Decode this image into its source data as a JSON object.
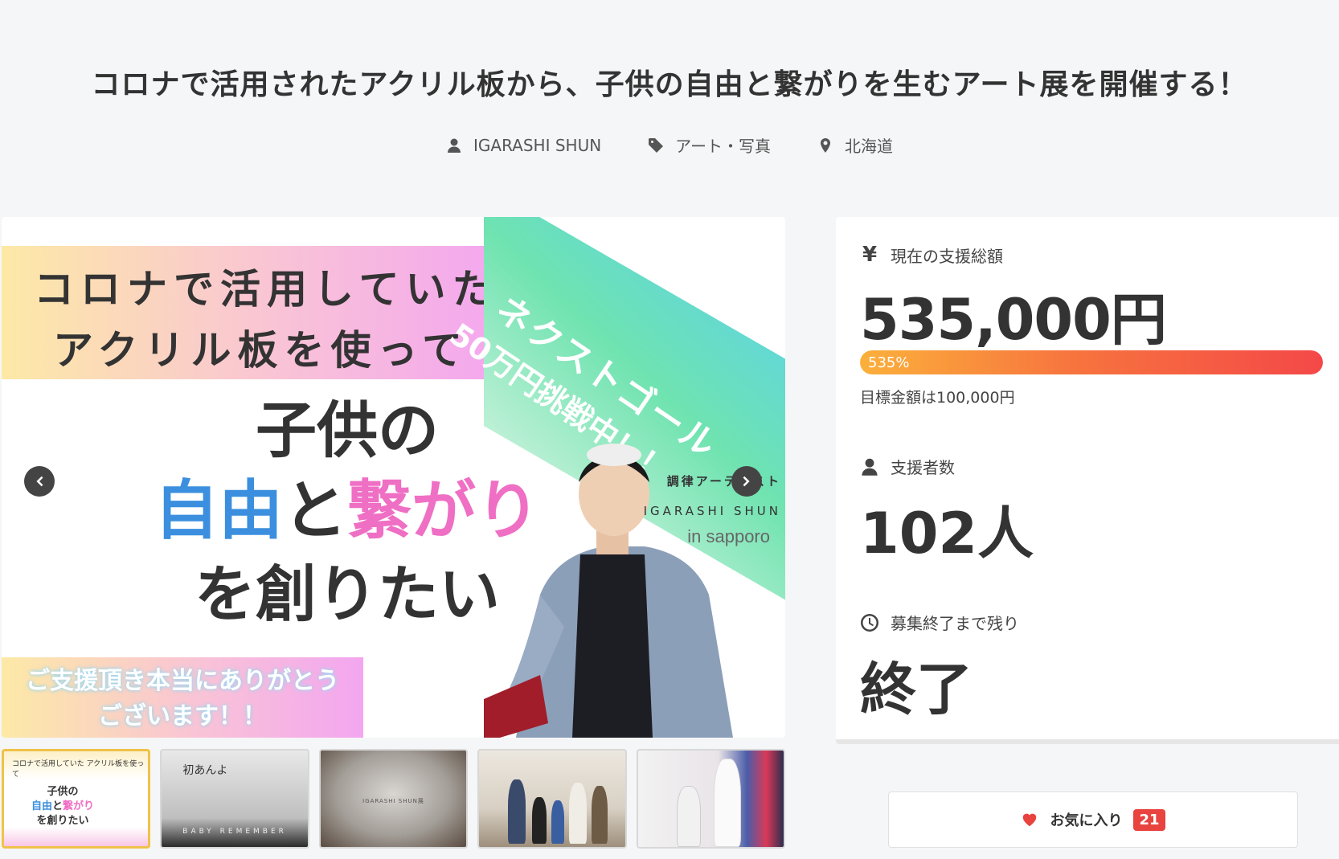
{
  "project": {
    "title": "コロナで活用されたアクリル板から、子供の自由と繋がりを生むアート展を開催する！",
    "owner": "IGARASHI SHUN",
    "category": "アート・写真",
    "location": "北海道"
  },
  "hero": {
    "band_line1": "コロナで活用していた",
    "band_line2": "アクリル板を使って",
    "goal_line1": "ネクストゴール",
    "goal_line2": "50万円挑戦中！！",
    "main_line1": "子供の",
    "main_blue": "自由",
    "main_mid": "と",
    "main_pink": "繋がり",
    "main_line3": "を創りたい",
    "credit_role": "調律アーティスト",
    "credit_name": "IGARASHI SHUN",
    "credit_place": "in sapporo",
    "thanks_line1": "ご支援頂き本当にありがとう",
    "thanks_line2": "ございます！！"
  },
  "thumbnails": {
    "t1_top": "コロナで活用していた アクリル板を使って",
    "t1_line1": "子供の",
    "t1_blue": "自由",
    "t1_mid": "と",
    "t1_pink": "繋がり",
    "t1_line3": "を創りたい",
    "t2_heading": "初あんよ",
    "t2_caption": "BABY REMEMBER",
    "t3_caption": "IGARASHI SHUN展"
  },
  "stats": {
    "amount_label": "現在の支援総額",
    "amount": "535,000円",
    "percent": "535%",
    "percent_fill": 1.0,
    "goal_text": "目標金額は100,000円",
    "backers_label": "支援者数",
    "backers": "102人",
    "remaining_label": "募集終了まで残り",
    "remaining": "終了"
  },
  "favorite": {
    "label": "お気に入り",
    "count": "21"
  },
  "icons": {
    "owner": "user-icon",
    "category": "tag-icon",
    "location": "map-pin-icon",
    "amount": "yen-icon",
    "backers": "user-icon",
    "remaining": "clock-icon",
    "favorite": "heart-icon"
  },
  "colors": {
    "accent_red": "#e8433f",
    "progress_start": "#fbb03b",
    "progress_end": "#f44848",
    "hero_blue": "#3b8fde",
    "hero_pink": "#ef6fc4"
  }
}
